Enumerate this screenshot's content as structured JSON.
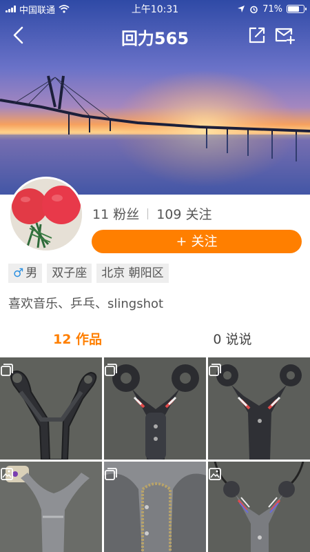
{
  "status_bar": {
    "carrier": "中国联通",
    "time": "上午10:31",
    "battery": "71%",
    "battery_level": 0.71
  },
  "nav": {
    "title": "回力565",
    "back_icon": "back-arrow-icon",
    "share_icon": "share-external-icon",
    "mail_icon": "mail-add-icon"
  },
  "profile": {
    "fans": "11 粉丝",
    "following": "109 关注",
    "follow_button": "+ 关注",
    "tags": {
      "gender": "男",
      "zodiac": "双子座",
      "location": "北京 朝阳区"
    },
    "bio": "喜欢音乐、乒乓、slingshot"
  },
  "tabs": {
    "works": "12 作品",
    "posts": "0 说说"
  },
  "colors": {
    "accent": "#ff7f00",
    "male": "#2a8fe0"
  }
}
